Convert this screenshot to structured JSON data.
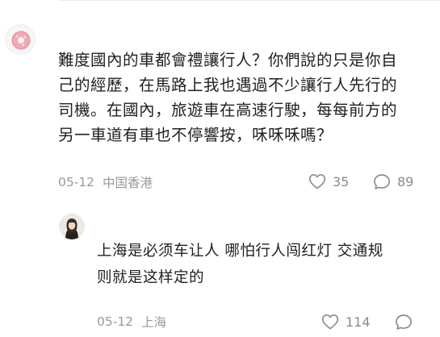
{
  "comments": [
    {
      "avatar_icon": "donut-avatar-icon",
      "lines": [
        "難度國內的車都會禮讓行人？你們說的只是你自",
        "己的經歷，在馬路上我也遇過不少讓行人先行的",
        "司機。在國內，旅遊車在高速行駛，每每前方的",
        "另一車道有車也不停響按，咊咊咊嗎？"
      ],
      "date": "05-12",
      "location": "中国香港",
      "likes": "35",
      "replies": "89"
    },
    {
      "avatar_icon": "user-photo-avatar",
      "lines": [
        "上海是必须车让人 哪怕行人闯红灯 交通规",
        "则就是这样定的"
      ],
      "date": "05-12",
      "location": "上海",
      "likes": "114",
      "replies": ""
    }
  ],
  "icons": {
    "like": "heart-icon",
    "reply": "comment-bubble-icon"
  },
  "colors": {
    "meta_text": "#999999",
    "body_text": "#1f1f1f",
    "icon": "#8a8a8a"
  }
}
